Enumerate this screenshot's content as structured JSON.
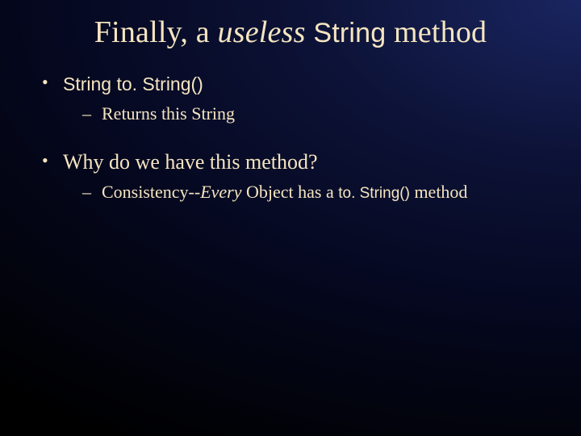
{
  "title": {
    "part1": "Finally, a ",
    "part2_italic": "useless",
    "part3_space": " ",
    "part4_sans": "String",
    "part5": " method"
  },
  "bullets": [
    {
      "main_sans": "String to. String()",
      "sub": {
        "text": "Returns this String"
      }
    },
    {
      "main_plain": "Why do we have this method?",
      "sub": {
        "prefix": "Consistency--",
        "italic": "Every",
        "mid": " Object has a ",
        "code": "to. String()",
        "suffix": " method"
      }
    }
  ]
}
